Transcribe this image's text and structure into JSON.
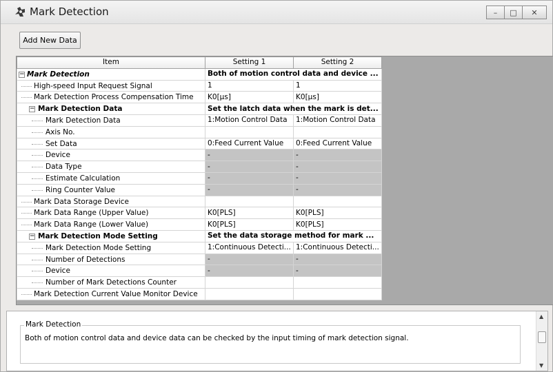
{
  "window": {
    "title": "Mark Detection",
    "icon": "gear-icon"
  },
  "toolbar": {
    "add_new_data_label": "Add New Data"
  },
  "grid": {
    "headers": [
      "Item",
      "Setting 1",
      "Setting 2"
    ],
    "rows": [
      {
        "item": "Mark Detection",
        "s1": "Both of motion control data and device ...",
        "s2": "",
        "bold": true,
        "italic": true,
        "merged": true
      },
      {
        "item": "High-speed Input Request Signal",
        "s1": "1",
        "s2": "1"
      },
      {
        "item": "Mark Detection Process Compensation Time",
        "s1": "K0[µs]",
        "s2": "K0[µs]"
      },
      {
        "item": "Mark Detection Data",
        "s1": "Set the latch data when the mark is det...",
        "s2": "",
        "bold": true,
        "merged": true
      },
      {
        "item": "Mark Detection Data",
        "s1": "1:Motion Control Data",
        "s2": "1:Motion Control Data"
      },
      {
        "item": "Axis No.",
        "s1": "",
        "s2": ""
      },
      {
        "item": "Set Data",
        "s1": "0:Feed Current Value",
        "s2": "0:Feed Current Value"
      },
      {
        "item": "Device",
        "s1": "-",
        "s2": "-",
        "gray": true
      },
      {
        "item": "Data Type",
        "s1": "-",
        "s2": "-",
        "gray": true
      },
      {
        "item": "Estimate Calculation",
        "s1": "-",
        "s2": "-",
        "gray": true
      },
      {
        "item": "Ring Counter Value",
        "s1": "-",
        "s2": "-",
        "gray": true
      },
      {
        "item": "Mark Data Storage Device",
        "s1": "",
        "s2": ""
      },
      {
        "item": "Mark Data Range (Upper Value)",
        "s1": "K0[PLS]",
        "s2": "K0[PLS]"
      },
      {
        "item": "Mark Data Range (Lower Value)",
        "s1": "K0[PLS]",
        "s2": "K0[PLS]"
      },
      {
        "item": "Mark Detection Mode Setting",
        "s1": "Set the data storage method for mark ...",
        "s2": "",
        "bold": true,
        "merged": true
      },
      {
        "item": "Mark Detection Mode Setting",
        "s1": "1:Continuous Detecti...",
        "s2": "1:Continuous Detecti..."
      },
      {
        "item": "Number of Detections",
        "s1": "-",
        "s2": "-",
        "gray": true
      },
      {
        "item": "Device",
        "s1": "-",
        "s2": "-",
        "gray": true
      },
      {
        "item": "Number of Mark Detections Counter",
        "s1": "",
        "s2": ""
      },
      {
        "item": "Mark Detection Current Value Monitor Device",
        "s1": "",
        "s2": ""
      }
    ]
  },
  "description": {
    "group_title": "Mark Detection",
    "text": "Both of motion control data and device data can be checked by the input timing of mark detection signal."
  },
  "window_buttons": {
    "minimize": "–",
    "maximize": "□",
    "close": "✕"
  },
  "scrollbar": {
    "up": "▲",
    "down": "▼"
  },
  "colors": {
    "disabled_cell": "#c4c4c4",
    "grid_background": "#a9a9a9"
  }
}
